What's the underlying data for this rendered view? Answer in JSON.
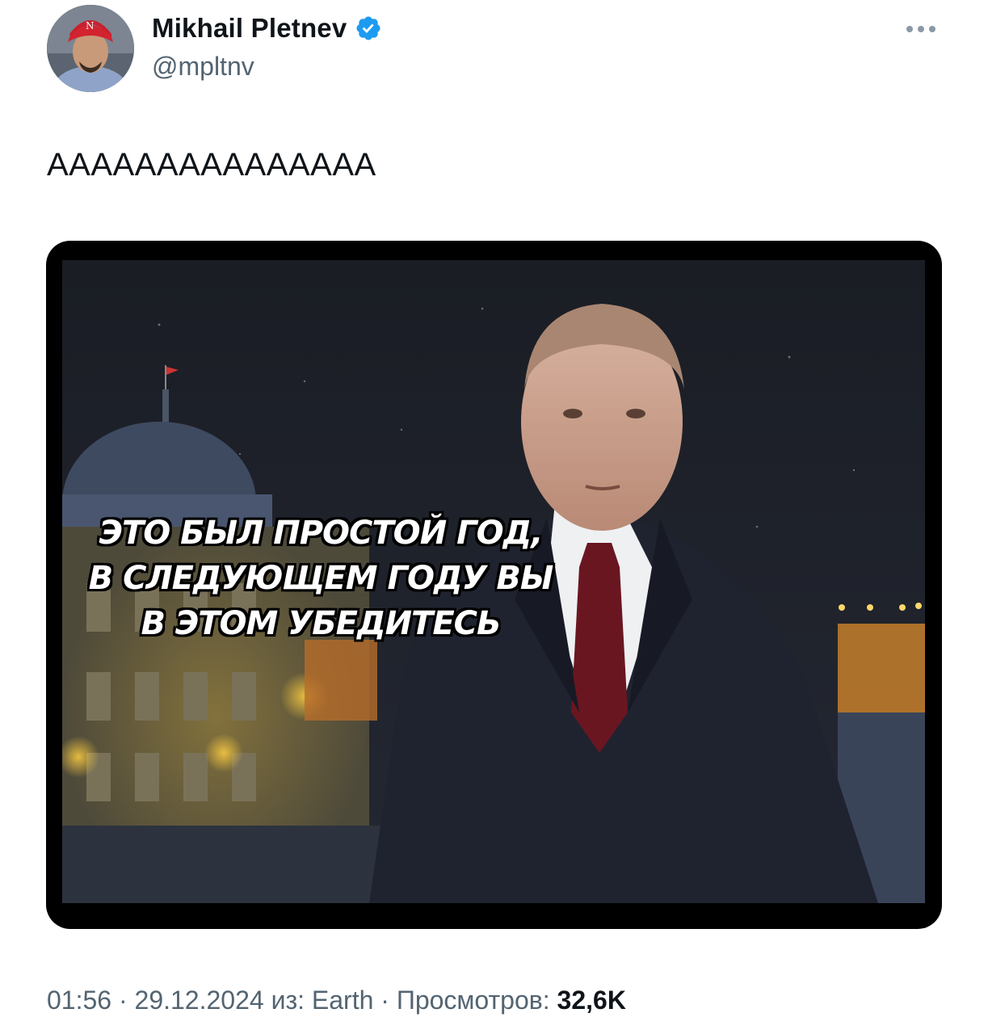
{
  "author": {
    "display_name": "Mikhail Pletnev",
    "handle": "@mpltnv",
    "verified": true
  },
  "tweet": {
    "text": "AAAAAAAAAAAAAAA",
    "media": {
      "caption_lines": [
        "ЭТО БЫЛ ПРОСТОЙ ГОД,",
        "В СЛЕДУЮЩЕМ ГОДУ ВЫ",
        "В ЭТОМ УБЕДИТЕСЬ"
      ]
    }
  },
  "meta": {
    "time": "01:56",
    "sep1": " · ",
    "date": "29.12.2024",
    "source_prefix": " из: ",
    "source": "Earth",
    "sep2": " · ",
    "views_label": "Просмотров: ",
    "views_count": "32,6K"
  },
  "colors": {
    "verified": "#1d9bf0",
    "secondary_text": "#536471",
    "primary_text": "#0f1419"
  },
  "icons": {
    "verified": "verified-badge-icon",
    "more": "more-dots-icon"
  }
}
